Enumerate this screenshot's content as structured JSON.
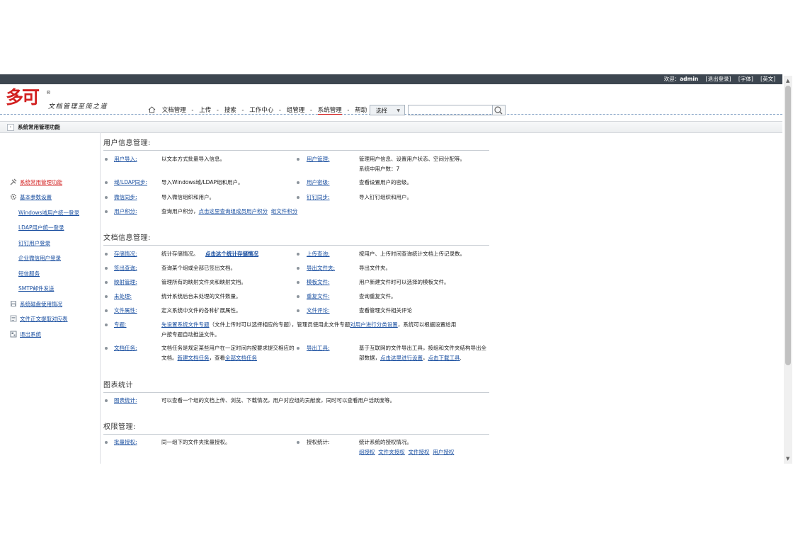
{
  "topbar": {
    "welcome": "欢迎：",
    "user": "admin",
    "logout": "[退出登录]",
    "font": "[字体]",
    "lang": "[英文]"
  },
  "logo": {
    "mark": "多可",
    "reg": "®",
    "slogan": "文档管理至简之道"
  },
  "nav": {
    "items": [
      "文档管理",
      "上传",
      "搜索",
      "工作中心",
      "组管理",
      "系统管理",
      "帮助"
    ],
    "separator": "-",
    "active_index": 5
  },
  "search": {
    "select_value": "选择",
    "input_value": ""
  },
  "breadcrumb": "系统常用管理功能",
  "sidebar": {
    "items": [
      {
        "label": "系统常用管理功能",
        "icon": "tools-icon"
      },
      {
        "label": "基本参数设置",
        "icon": "gear-icon"
      },
      {
        "label": "Windows域用户统一登录"
      },
      {
        "label": "LDAP用户统一登录"
      },
      {
        "label": "钉钉用户登录"
      },
      {
        "label": "企业微信用户登录"
      },
      {
        "label": "短信服务"
      },
      {
        "label": "SMTP邮件发送"
      },
      {
        "label": "系统磁盘使用情况",
        "icon": "disk-icon"
      },
      {
        "label": "文件正文提取对应表",
        "icon": "document-icon"
      },
      {
        "label": "退出系统",
        "icon": "exit-icon"
      }
    ]
  },
  "sections": {
    "user": {
      "title": "用户信息管理:",
      "import": {
        "k": "用户导入:",
        "d": "以文本方式批量导入信息。"
      },
      "manage": {
        "k": "用户管理:",
        "d": "管理用户信息、设置用户状态、空间分配等。",
        "d2": "系统中用户数：7"
      },
      "ldap": {
        "k": "域/LDAP同步:",
        "d": "导入Windows域/LDAP组和用户。"
      },
      "pwd": {
        "k": "用户密级:",
        "d": "查看设置用户的密级。"
      },
      "wechat": {
        "k": "微信同步:",
        "d": "导入微信组织和用户。"
      },
      "ding": {
        "k": "钉钉同步:",
        "d": "导入钉钉组织和用户。"
      },
      "points": {
        "k": "用户积分:",
        "d": "查询用户积分，",
        "l1": "点击这里查询组成员用户积分",
        "l2": "组文件积分"
      }
    },
    "doc": {
      "title": "文档信息管理:",
      "storage": {
        "k": "存储情况:",
        "d": "统计存储情况。",
        "l": "点击这个统计存储情况"
      },
      "upq": {
        "k": "上传查询:",
        "d": "按用户、上传时间查询统计文档上传记录数。"
      },
      "checkout": {
        "k": "签出查询:",
        "d": "查询某个组或全部已签出文档。"
      },
      "export": {
        "k": "导出文件夹:",
        "d": "导出文件夹。"
      },
      "map": {
        "k": "映射管理:",
        "d": "管理所有的映射文件夹和映射文档。"
      },
      "tpl": {
        "k": "模板文件:",
        "d": "用户新建文件时可以选择的模板文件。"
      },
      "unproc": {
        "k": "未处理:",
        "d": "统计系统后台未处理的文件数量。"
      },
      "dup": {
        "k": "重复文件:",
        "d": "查询重复文件。"
      },
      "attr": {
        "k": "文件属性:",
        "d": "定义系统中文件的各种扩展属性。"
      },
      "comment": {
        "k": "文件评论:",
        "d": "查看管理文件相关评论"
      },
      "topic": {
        "k": "专题:",
        "l1": "先设置系统文件专题",
        "t1": "（文件上传时可以选择相应的专题），管理员使用此文件专题",
        "l2": "对用户进行分类设置",
        "t2": "，系统可以根据设置给用户按专题自动推送文件。"
      },
      "task": {
        "k": "文档任务:",
        "t1": "文档任务是规定某些用户在一定时间内按要求提交相应的文档。",
        "l1": "新建文档任务",
        "t2": "，查看",
        "l2": "全部文档任务"
      },
      "exporttool": {
        "k": "导出工具:",
        "t1": "基于互联网的文件导出工具，按组和文件夹结构导出全部数据，",
        "l1": "点击这里进行设置",
        "t2": "，",
        "l2": "点击下载工具",
        "t3": "."
      }
    },
    "chart": {
      "title": "图表统计",
      "stats": {
        "k": "图表统计:",
        "d": "可以查看一个组的文档上传、浏览、下载情况，用户对应组的贡献度，同时可以查看用户活跃度等。"
      }
    },
    "perm": {
      "title": "权限管理:",
      "batch": {
        "k": "批量授权:",
        "d": "同一组下的文件夹批量授权。"
      },
      "pstat": {
        "k": "授权统计:",
        "d": "统计系统的授权情况。",
        "links": [
          "组授权",
          "文件夹授权",
          "文件授权",
          "用户授权"
        ]
      }
    }
  }
}
